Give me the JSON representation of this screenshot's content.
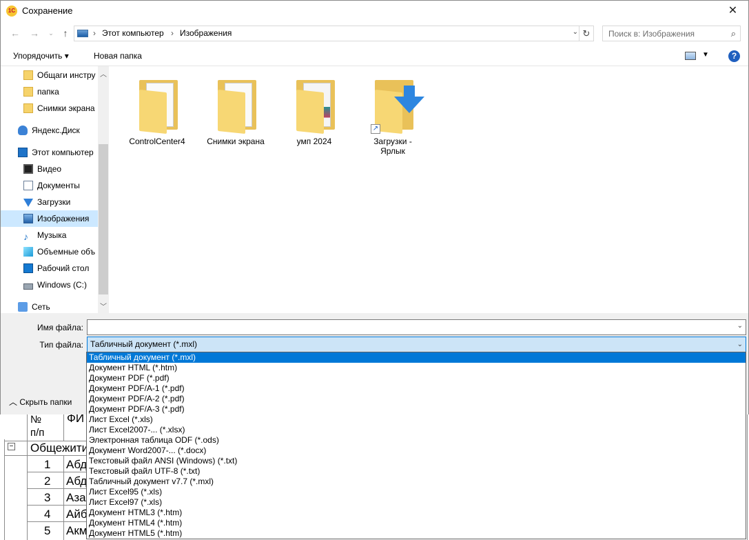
{
  "title": "Сохранение",
  "app_icon_text": "1С",
  "address": {
    "crumbs": [
      "Этот компьютер",
      "Изображения"
    ]
  },
  "search": {
    "placeholder": "Поиск в: Изображения"
  },
  "toolbar": {
    "organize": "Упорядочить ▾",
    "new_folder": "Новая папка"
  },
  "nav": {
    "items": [
      {
        "label": "Общаги инстру",
        "icon": "folder-icon"
      },
      {
        "label": "папка",
        "icon": "folder-icon"
      },
      {
        "label": "Снимки экрана",
        "icon": "folder-icon"
      },
      {
        "label": "Яндекс.Диск",
        "icon": "cloud-icon"
      },
      {
        "label": "Этот компьютер",
        "icon": "computer-icon"
      },
      {
        "label": "Видео",
        "icon": "video-icon"
      },
      {
        "label": "Документы",
        "icon": "documents-icon"
      },
      {
        "label": "Загрузки",
        "icon": "downloads-icon"
      },
      {
        "label": "Изображения",
        "icon": "pictures-icon",
        "selected": true
      },
      {
        "label": "Музыка",
        "icon": "music-icon"
      },
      {
        "label": "Объемные объ",
        "icon": "3d-objects-icon"
      },
      {
        "label": "Рабочий стол",
        "icon": "desktop-icon"
      },
      {
        "label": "Windows (C:)",
        "icon": "drive-icon"
      },
      {
        "label": "Сеть",
        "icon": "network-icon"
      }
    ]
  },
  "files": [
    {
      "name": "ControlCenter4"
    },
    {
      "name": "Снимки экрана"
    },
    {
      "name": "умп 2024"
    },
    {
      "name": "Загрузки - Ярлык"
    }
  ],
  "form": {
    "filename_label": "Имя файла:",
    "filename_value": "",
    "filetype_label": "Тип файла:",
    "filetype_value": "Табличный документ (*.mxl)",
    "hide_folders": "Скрыть папки"
  },
  "filetype_options": [
    "Табличный документ (*.mxl)",
    "Документ HTML (*.htm)",
    "Документ PDF (*.pdf)",
    "Документ PDF/A-1 (*.pdf)",
    "Документ PDF/A-2 (*.pdf)",
    "Документ PDF/A-3 (*.pdf)",
    "Лист Excel (*.xls)",
    "Лист Excel2007-... (*.xlsx)",
    "Электронная таблица ODF (*.ods)",
    "Документ Word2007-... (*.docx)",
    "Текстовый файл ANSI (Windows) (*.txt)",
    "Текстовый файл UTF-8 (*.txt)",
    "Табличный документ v7.7 (*.mxl)",
    "Лист Excel95 (*.xls)",
    "Лист Excel97 (*.xls)",
    "Документ HTML3 (*.htm)",
    "Документ HTML4 (*.htm)",
    "Документ HTML5 (*.htm)"
  ],
  "background_sheet": {
    "header_num": "№\nп/п",
    "header_fio": "ФИ",
    "group": "Общежити",
    "rows": [
      {
        "n": "1",
        "name": "Абд"
      },
      {
        "n": "2",
        "name": "Абд"
      },
      {
        "n": "3",
        "name": "Аза"
      },
      {
        "n": "4",
        "name": "Айб"
      },
      {
        "n": "5",
        "name": "Акм"
      }
    ]
  }
}
